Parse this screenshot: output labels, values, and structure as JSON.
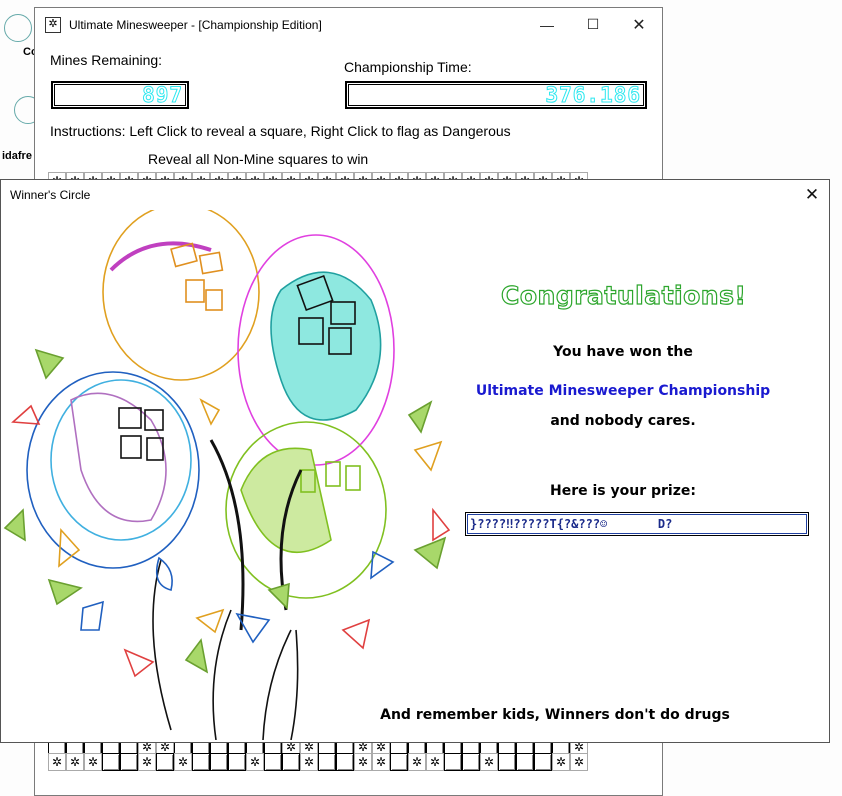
{
  "desktop": {
    "icon_label_1": "Co",
    "icon_label_2": "idafre"
  },
  "main_window": {
    "title": "Ultimate Minesweeper - [Championship Edition]",
    "icon": "mine-icon",
    "controls": {
      "minimize": "—",
      "maximize": "☐",
      "close": "✕"
    },
    "mines_label": "Mines Remaining:",
    "mines_value": "897",
    "time_label": "Championship Time:",
    "time_value": "376.186",
    "instructions": "Instructions: Left Click to reveal a square, Right Click to flag as Dangerous",
    "goal": "Reveal all Non-Mine squares to win",
    "accent_lcd": "#2ee8f0"
  },
  "dialog": {
    "title": "Winner's Circle",
    "close": "✕",
    "congrats": "Congratulations!",
    "line1": "You have won the",
    "line2": "Ultimate Minesweeper Championship",
    "line3": "and nobody cares.",
    "prize_label": "Here is your prize:",
    "prize_value": "}????‼?????T{?&???☺       D?",
    "footer": "And remember kids, Winners don't do drugs",
    "colors": {
      "congrats": "#2da62d",
      "highlight": "#1a1ad0"
    }
  }
}
